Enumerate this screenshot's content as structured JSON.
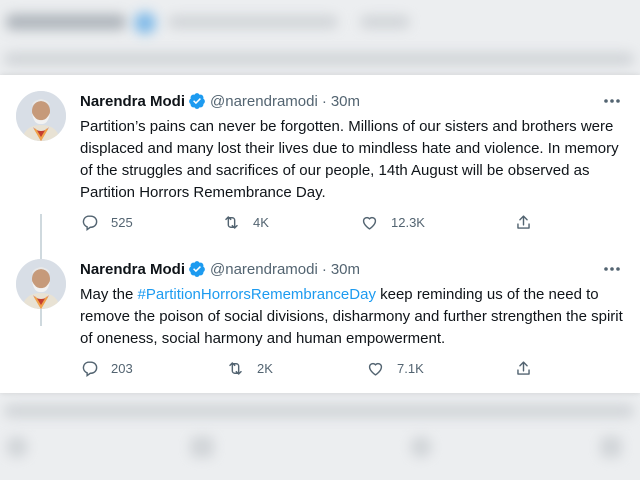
{
  "tweets": [
    {
      "author": {
        "name": "Narendra Modi",
        "handle": "@narendramodi"
      },
      "separator": "·",
      "time": "30m",
      "text": "Partition’s pains can never be forgotten. Millions of our sisters and brothers were displaced and many lost their lives due to mindless hate and violence. In memory of the struggles and sacrifices of our people, 14th August will be observed as Partition Horrors Remembrance Day.",
      "stats": {
        "replies": "525",
        "retweets": "4K",
        "likes": "12.3K"
      }
    },
    {
      "author": {
        "name": "Narendra Modi",
        "handle": "@narendramodi"
      },
      "separator": "·",
      "time": "30m",
      "text_before": "May the ",
      "hashtag": "#PartitionHorrorsRemembranceDay",
      "text_after": " keep reminding us of the need to remove the poison of social divisions, disharmony and further strengthen the spirit of oneness, social harmony and human empowerment.",
      "stats": {
        "replies": "203",
        "retweets": "2K",
        "likes": "7.1K"
      }
    }
  ],
  "colors": {
    "accent": "#1d9bf0",
    "text": "#0f1419",
    "muted": "#536471",
    "thread_line": "#cfd9de",
    "background_blur": "#e9ebed"
  },
  "icons": [
    "verified-badge-icon",
    "more-options-icon",
    "reply-icon",
    "retweet-icon",
    "like-icon",
    "share-icon"
  ]
}
